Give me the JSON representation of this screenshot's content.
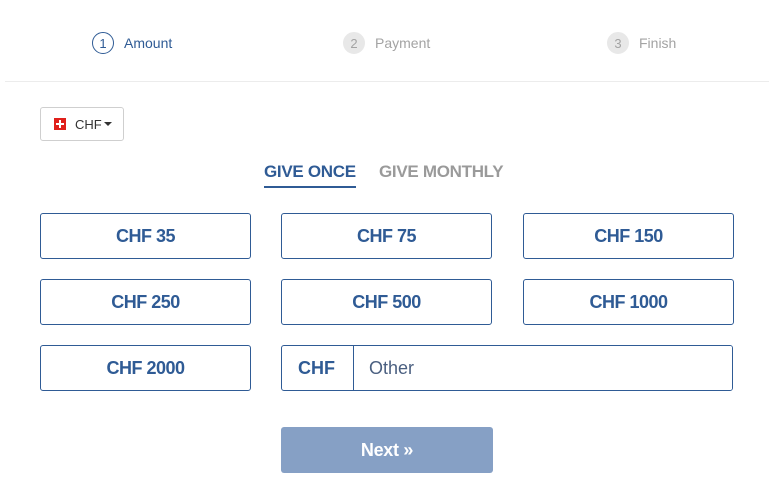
{
  "steps": [
    {
      "number": "1",
      "label": "Amount",
      "state": "active"
    },
    {
      "number": "2",
      "label": "Payment",
      "state": "inactive"
    },
    {
      "number": "3",
      "label": "Finish",
      "state": "inactive"
    }
  ],
  "currency": {
    "selected": "CHF",
    "flag_icon": "swiss-flag-icon"
  },
  "frequency": {
    "once_label": "GIVE ONCE",
    "monthly_label": "GIVE MONTHLY",
    "selected": "once"
  },
  "amounts": [
    "CHF 35",
    "CHF 75",
    "CHF 150",
    "CHF 250",
    "CHF 500",
    "CHF 1000",
    "CHF 2000"
  ],
  "other_amount": {
    "prefix": "CHF",
    "placeholder": "Other",
    "value": ""
  },
  "next_label": "Next »",
  "colors": {
    "accent": "#2f5b95",
    "next_button": "#86a0c5",
    "inactive_text": "#a3a3a3",
    "flag_red": "#e0201b"
  }
}
